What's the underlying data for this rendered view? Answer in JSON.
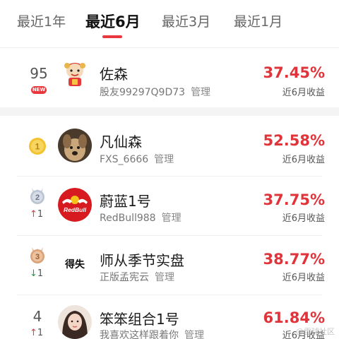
{
  "tabs": [
    {
      "label": "最近1年"
    },
    {
      "label": "最近6月"
    },
    {
      "label": "最近3月"
    },
    {
      "label": "最近1月"
    }
  ],
  "active_tab": "最近6月",
  "my_entry": {
    "rank": "95",
    "badge": "NEW",
    "name": "佐森",
    "sub": "股友99297Q9D73",
    "manage": "管理",
    "return": "37.45%",
    "return_label": "近6月收益"
  },
  "ranking": [
    {
      "medal": "1",
      "name": "凡仙森",
      "sub": "FXS_6666",
      "manage": "管理",
      "return": "52.58%",
      "return_label": "近6月收益"
    },
    {
      "medal": "2",
      "change": "1",
      "change_dir": "up",
      "name": "蔚蓝1号",
      "sub": "RedBull988",
      "manage": "管理",
      "avatar_text": "RedBull",
      "return": "37.75%",
      "return_label": "近6月收益"
    },
    {
      "medal": "3",
      "change": "1",
      "change_dir": "down",
      "name": "师从季节实盘",
      "sub": "正版孟宪云",
      "manage": "管理",
      "avatar_text": "得失",
      "return": "38.77%",
      "return_label": "近6月收益"
    },
    {
      "rank": "4",
      "change": "1",
      "change_dir": "up",
      "name": "笨笨组合1号",
      "sub": "我喜欢这样跟着你",
      "manage": "管理",
      "return": "61.84%",
      "return_label": "近6月收益"
    }
  ],
  "watermark": "@雪球社区",
  "icons": {
    "up_arrow": "up-arrow-icon",
    "down_arrow": "down-arrow-icon",
    "medal": "medal-icon"
  },
  "colors": {
    "accent": "#e8383d",
    "gain": "#e0343a",
    "down": "#1f9d3d",
    "gold": "#f2c230",
    "silver": "#b9c3d1",
    "bronze": "#d9a27a"
  }
}
